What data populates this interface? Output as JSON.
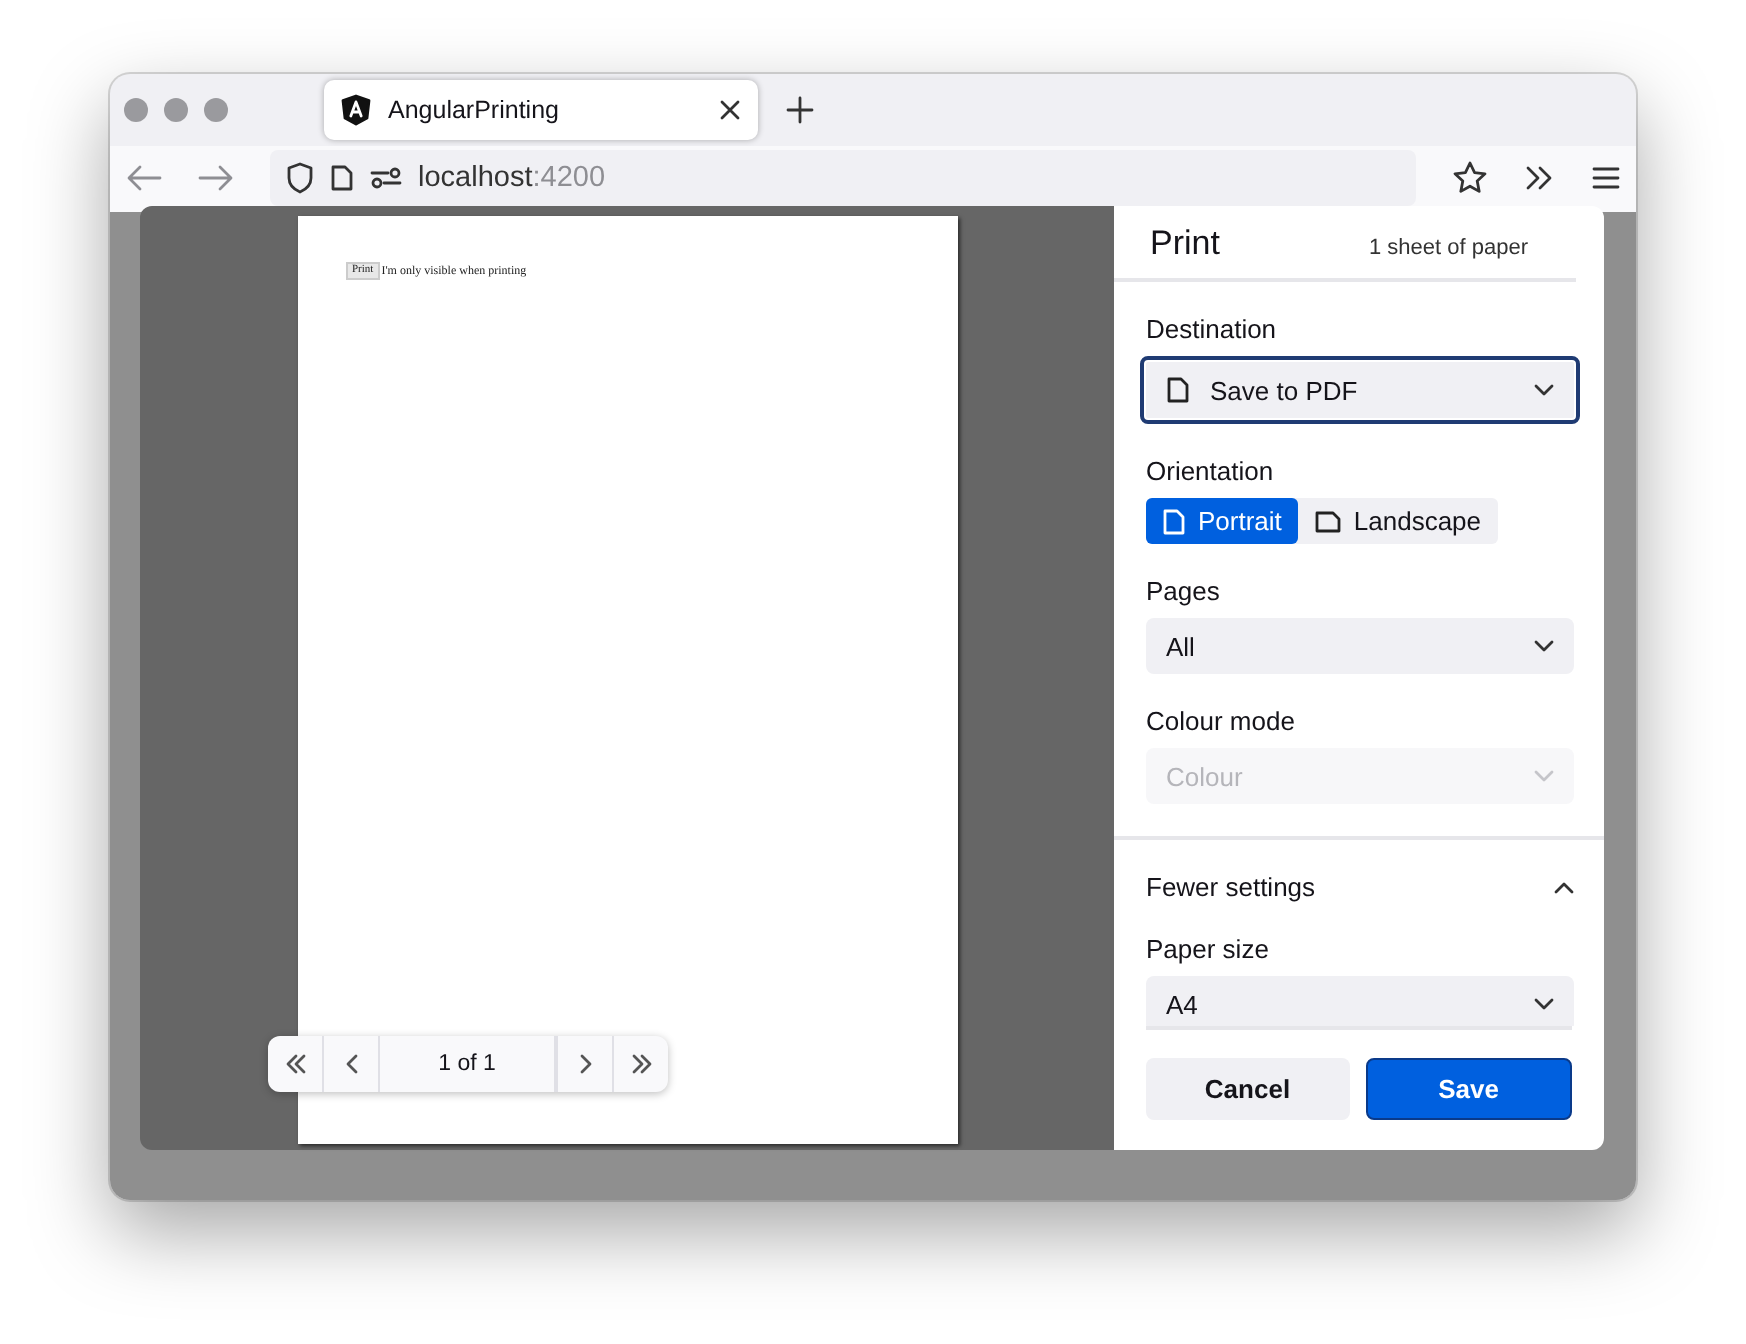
{
  "browser": {
    "tab": {
      "title": "AngularPrinting"
    },
    "address": {
      "host": "localhost",
      "port": ":4200"
    }
  },
  "preview": {
    "page": {
      "button": "Print",
      "text": "I'm only visible when printing"
    },
    "pager": {
      "label": "1 of 1"
    }
  },
  "print": {
    "title": "Print",
    "summary": "1 sheet of paper",
    "settings": [
      {
        "kind": "destination",
        "label": "Destination",
        "value": "Save to PDF",
        "focused": true,
        "disabled": false
      },
      {
        "kind": "orientation",
        "label": "Orientation",
        "options": [
          {
            "label": "Portrait",
            "selected": true
          },
          {
            "label": "Landscape",
            "selected": false
          }
        ]
      },
      {
        "kind": "select",
        "label": "Pages",
        "value": "All",
        "focused": false,
        "disabled": false
      },
      {
        "kind": "select",
        "label": "Colour mode",
        "value": "Colour",
        "focused": false,
        "disabled": true
      },
      {
        "kind": "expander",
        "label": "Fewer settings",
        "expanded": true
      },
      {
        "kind": "select",
        "label": "Paper size",
        "value": "A4",
        "focused": false,
        "disabled": false
      }
    ],
    "buttons": [
      {
        "label": "Cancel",
        "primary": false
      },
      {
        "label": "Save",
        "primary": true
      }
    ]
  }
}
